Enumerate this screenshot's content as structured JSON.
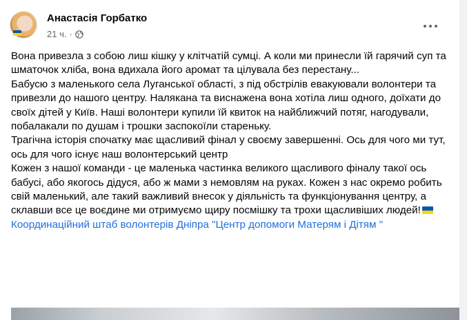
{
  "post": {
    "author": "Анастасія Горбатко",
    "time": "21 ч.",
    "separator": "·",
    "paragraphs": [
      "Вона привезла з собою лиш кішку у клітчатій сумці. А коли ми принесли їй гарячий суп та шматочок хліба, вона вдихала його аромат та цілувала без перестану...",
      "Бабусю з маленького села Луганської області, з під обстрілів евакуювали волонтери та привезли до нашого центру. Налякана та виснажена вона хотіла лиш одного, доїхати до своїх дітей у Київ. Наші волонтери купили їй квиток на найближчий потяг, нагодували, побалакали по душам і трошки заспокоїли старен­ьку.",
      "Трагічна історія спочатку має щасливий фінал у своєму завершенні. Ось для чого ми тут, ось для чого існує наш волонтерський центр",
      "Кожен з нашої команди - це маленька частинка великого щасливого фіналу такої ось бабусі, або якогось дідуся, або ж мами з немовлям на руках. Кожен з нас окремо робить свій маленький, але такий важливий внесок у діяльність та функціонування центру, а склавши все це воєдине ми отримуємо щиру посмішку та трохи щасливіших людей!"
    ],
    "link_text": "Координаційний штаб волонтерів Дніпра \"Центр допомоги Матерям і Дітям \"",
    "icons": {
      "globe": "globe-icon",
      "more": "more-options-icon",
      "flag": "ukraine-flag-icon"
    },
    "colors": {
      "link": "#216fdb",
      "flag_blue": "#0057b7",
      "flag_yellow": "#ffd700"
    }
  }
}
